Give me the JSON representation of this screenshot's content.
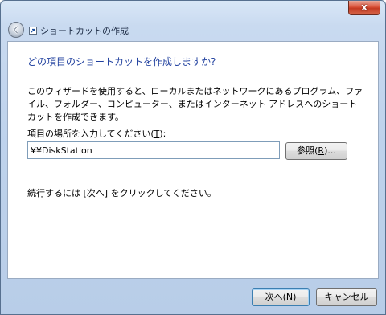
{
  "titlebar": {
    "close_label": "x"
  },
  "navbar": {
    "title": "ショートカットの作成"
  },
  "main": {
    "heading": "どの項目のショートカットを作成しますか?",
    "description": "このウィザードを使用すると、ローカルまたはネットワークにあるプログラム、ファイル、フォルダー、コンピューター、またはインターネット アドレスへのショートカットを作成できます。",
    "location_label_prefix": "項目の場所を入力してください(",
    "location_label_key": "T",
    "location_label_suffix": "):",
    "location_value": "¥¥DiskStation",
    "browse_label_prefix": "参照(",
    "browse_label_key": "R",
    "browse_label_suffix": ")...",
    "hint": "続行するには [次へ] をクリックしてください。"
  },
  "footer": {
    "next_label": "次へ(N)",
    "cancel_label": "キャンセル"
  },
  "colors": {
    "heading": "#1f3f9e",
    "close_button": "#c43a22"
  },
  "icons": [
    "back-arrow-icon",
    "shortcut-wizard-icon",
    "close-icon"
  ]
}
